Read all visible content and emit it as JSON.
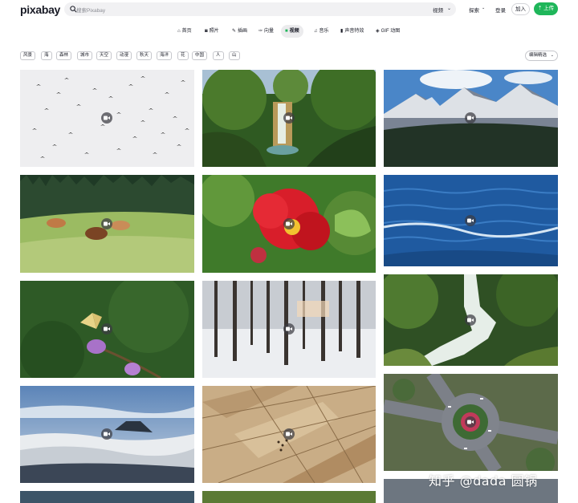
{
  "header": {
    "logo": "pixabay",
    "search_placeholder": "搜索Pixabay",
    "search_type": "视频",
    "explore": "探索",
    "login": "登录",
    "join": "加入",
    "upload": "上传"
  },
  "categories": [
    {
      "label": "首页",
      "icon": "home-icon",
      "glyph": "⌂",
      "active": false
    },
    {
      "label": "照片",
      "icon": "camera-icon",
      "glyph": "◙",
      "active": false
    },
    {
      "label": "插画",
      "icon": "brush-icon",
      "glyph": "✎",
      "active": false
    },
    {
      "label": "向量",
      "icon": "vector-icon",
      "glyph": "✑",
      "active": false
    },
    {
      "label": "视频",
      "icon": "video-icon",
      "glyph": "▶",
      "active": true
    },
    {
      "label": "音乐",
      "icon": "music-icon",
      "glyph": "♫",
      "active": false
    },
    {
      "label": "声音特效",
      "icon": "sound-effects-icon",
      "glyph": "▮",
      "active": false
    },
    {
      "label": "GIF 动图",
      "icon": "gif-icon",
      "glyph": "◈",
      "active": false
    }
  ],
  "tags": [
    "风景",
    "海",
    "森林",
    "城市",
    "天空",
    "动漫",
    "秋天",
    "海洋",
    "花",
    "中国",
    "人",
    "山"
  ],
  "sort": {
    "label": "编辑精选"
  },
  "tiles": [
    {
      "name": "birds",
      "badge": "video-icon"
    },
    {
      "name": "waterfall-jungle",
      "badge": "video-icon"
    },
    {
      "name": "snowy-mountains",
      "badge": "video-icon"
    },
    {
      "name": "cows-meadow",
      "badge": "video-icon"
    },
    {
      "name": "red-flower",
      "badge": "video-icon"
    },
    {
      "name": "ocean-waves",
      "badge": "video-icon"
    },
    {
      "name": "butterfly-flower",
      "badge": "video-icon"
    },
    {
      "name": "winter-forest",
      "badge": "video-icon"
    },
    {
      "name": "forest-stream",
      "badge": "video-icon"
    },
    {
      "name": "mount-fuji-clouds",
      "badge": "video-icon"
    },
    {
      "name": "aerial-fields",
      "badge": "video-icon"
    },
    {
      "name": "roundabout-aerial",
      "badge": "video-icon"
    }
  ],
  "watermark": "知乎 @dada 圆锅",
  "colors": {
    "accent": "#1fb65a",
    "text": "#191b26",
    "muted": "#8b8d94"
  }
}
